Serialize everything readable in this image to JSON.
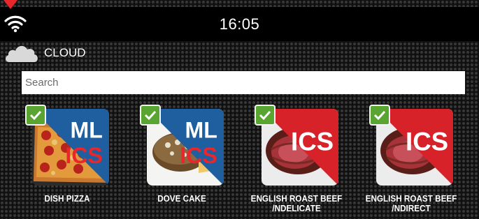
{
  "status_bar": {
    "time": "16:05"
  },
  "cloud": {
    "label": "CLOUD"
  },
  "search": {
    "placeholder": "Search"
  },
  "recipes": [
    {
      "name": "DISH PIZZA",
      "badge_top": "ML",
      "badge_bottom": "ICS",
      "image": "pizza",
      "selected": true
    },
    {
      "name": "DOVE CAKE",
      "badge_top": "ML",
      "badge_bottom": "ICS",
      "image": "cake",
      "selected": true
    },
    {
      "name": "ENGLISH ROAST BEEF /NDELICATE",
      "badge_top": "",
      "badge_bottom": "ICS",
      "image": "roast-beef",
      "selected": true
    },
    {
      "name": "ENGLISH ROAST BEEF /NDIRECT",
      "badge_top": "",
      "badge_bottom": "ICS",
      "image": "roast-beef",
      "selected": true
    }
  ],
  "colors": {
    "check": "#5aa432",
    "badge_blue": "#1f5fa0",
    "badge_red": "#d8222a",
    "alert": "#e8262b"
  }
}
